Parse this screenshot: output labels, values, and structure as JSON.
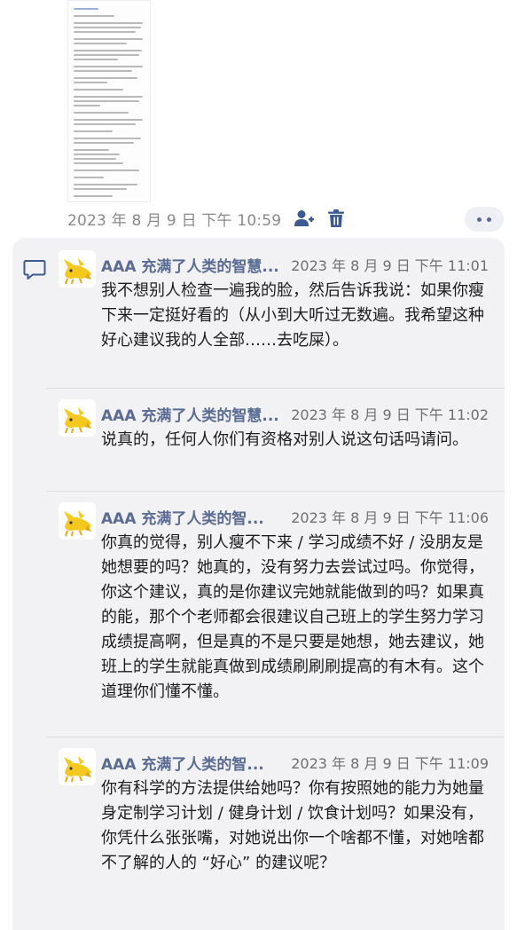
{
  "attachment": {
    "timestamp": "2023 年 8 月 9 日 下午 10:59"
  },
  "icons": {
    "assign": "person-add-icon",
    "delete": "trash-icon",
    "more": "more-dots-icon",
    "comment": "comment-icon",
    "avatar": "yellow-cat-avatar"
  },
  "colors": {
    "author": "#5a6c93",
    "accent": "#3d5a94",
    "panel": "#f2f2f5"
  },
  "comments": [
    {
      "author": "AAA 充满了人类的智慧...",
      "time": "2023 年 8 月 9 日 下午 11:01",
      "text": "我不想别人检查一遍我的脸，然后告诉我说：如果你瘦下来一定挺好看的（从小到大听过无数遍。我希望这种好心建议我的人全部……去吃屎）。"
    },
    {
      "author": "AAA 充满了人类的智慧...",
      "time": "2023 年 8 月 9 日 下午 11:02",
      "text": "说真的，任何人你们有资格对别人说这句话吗请问。"
    },
    {
      "author": "AAA 充满了人类的智...",
      "time": "2023 年 8 月 9 日 下午 11:06",
      "text": "你真的觉得，别人瘦不下来 / 学习成绩不好 / 没朋友是她想要的吗？她真的，没有努力去尝试过吗。你觉得，你这个建议，真的是你建议完她就能做到的吗？如果真的能，那个个老师都会很建议自己班上的学生努力学习成绩提高啊，但是真的不是只要是她想，她去建议，她班上的学生就能真做到成绩刷刷刷提高的有木有。这个道理你们懂不懂。"
    },
    {
      "author": "AAA 充满了人类的智...",
      "time": "2023 年 8 月 9 日 下午 11:09",
      "text": "你有科学的方法提供给她吗？你有按照她的能力为她量身定制学习计划 / 健身计划 / 饮食计划吗？如果没有，你凭什么张张嘴，对她说出你一个啥都不懂，对她啥都不了解的人的 “好心” 的建议呢？"
    }
  ]
}
